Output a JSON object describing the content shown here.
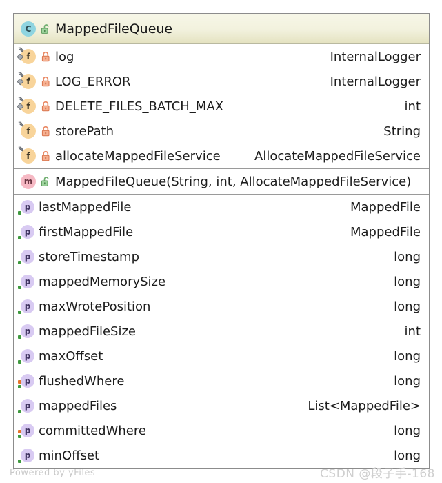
{
  "diagram": {
    "kind": "uml-class-node",
    "class_icon": "class-icon",
    "class_visibility_icon": "unlock-icon",
    "class_name": "MappedFileQueue",
    "colors": {
      "header_gradient_top": "#f7f7e8",
      "header_gradient_bottom": "#e4e2c0",
      "border": "#8c8c8c",
      "class_badge": "#8fd4e0",
      "field_badge": "#f8d49a",
      "method_badge": "#f6b9c4",
      "property_badge": "#d8caf2",
      "private_lock": "#ef8f6e",
      "public_lock": "#8cc98c",
      "text": "#1d1d1d",
      "watermark": "#c9c9c9"
    },
    "sections": [
      {
        "id": "fields",
        "rows": [
          {
            "icon": "static-field-icon",
            "lock": "lock-icon",
            "visibility": "private",
            "static": true,
            "name": "log",
            "type": "InternalLogger"
          },
          {
            "icon": "static-field-icon",
            "lock": "lock-icon",
            "visibility": "private",
            "static": true,
            "name": "LOG_ERROR",
            "type": "InternalLogger"
          },
          {
            "icon": "static-field-icon",
            "lock": "lock-icon",
            "visibility": "private",
            "static": true,
            "name": "DELETE_FILES_BATCH_MAX",
            "type": "int"
          },
          {
            "icon": "field-icon",
            "lock": "lock-icon",
            "visibility": "private",
            "static": false,
            "name": "storePath",
            "type": "String"
          },
          {
            "icon": "field-icon",
            "lock": "lock-icon",
            "visibility": "private",
            "static": false,
            "name": "allocateMappedFileService",
            "type": "AllocateMappedFileService"
          }
        ]
      },
      {
        "id": "constructors",
        "rows": [
          {
            "icon": "method-icon",
            "lock": "unlock-icon",
            "visibility": "public",
            "static": false,
            "name": "MappedFileQueue(String, int, AllocateMappedFileService)",
            "type": ""
          }
        ]
      },
      {
        "id": "properties",
        "rows": [
          {
            "icon": "property-icon",
            "lock": "",
            "visibility": "",
            "read": true,
            "write": false,
            "name": "lastMappedFile",
            "type": "MappedFile"
          },
          {
            "icon": "property-icon",
            "lock": "",
            "visibility": "",
            "read": true,
            "write": false,
            "name": "firstMappedFile",
            "type": "MappedFile"
          },
          {
            "icon": "property-icon",
            "lock": "",
            "visibility": "",
            "read": true,
            "write": false,
            "name": "storeTimestamp",
            "type": "long"
          },
          {
            "icon": "property-icon",
            "lock": "",
            "visibility": "",
            "read": true,
            "write": false,
            "name": "mappedMemorySize",
            "type": "long"
          },
          {
            "icon": "property-icon",
            "lock": "",
            "visibility": "",
            "read": true,
            "write": false,
            "name": "maxWrotePosition",
            "type": "long"
          },
          {
            "icon": "property-icon",
            "lock": "",
            "visibility": "",
            "read": true,
            "write": false,
            "name": "mappedFileSize",
            "type": "int"
          },
          {
            "icon": "property-icon",
            "lock": "",
            "visibility": "",
            "read": true,
            "write": false,
            "name": "maxOffset",
            "type": "long"
          },
          {
            "icon": "property-icon",
            "lock": "",
            "visibility": "",
            "read": true,
            "write": true,
            "name": "flushedWhere",
            "type": "long"
          },
          {
            "icon": "property-icon",
            "lock": "",
            "visibility": "",
            "read": true,
            "write": false,
            "name": "mappedFiles",
            "type": "List<MappedFile>"
          },
          {
            "icon": "property-icon",
            "lock": "",
            "visibility": "",
            "read": true,
            "write": true,
            "name": "committedWhere",
            "type": "long"
          },
          {
            "icon": "property-icon",
            "lock": "",
            "visibility": "",
            "read": true,
            "write": false,
            "name": "minOffset",
            "type": "long"
          }
        ]
      }
    ]
  },
  "watermarks": {
    "yfiles": "Powered by yFiles",
    "csdn": "CSDN @段子手-168"
  },
  "glyphs": {
    "class_letter": "C",
    "field_letter": "f",
    "method_letter": "m",
    "property_letter": "p"
  }
}
